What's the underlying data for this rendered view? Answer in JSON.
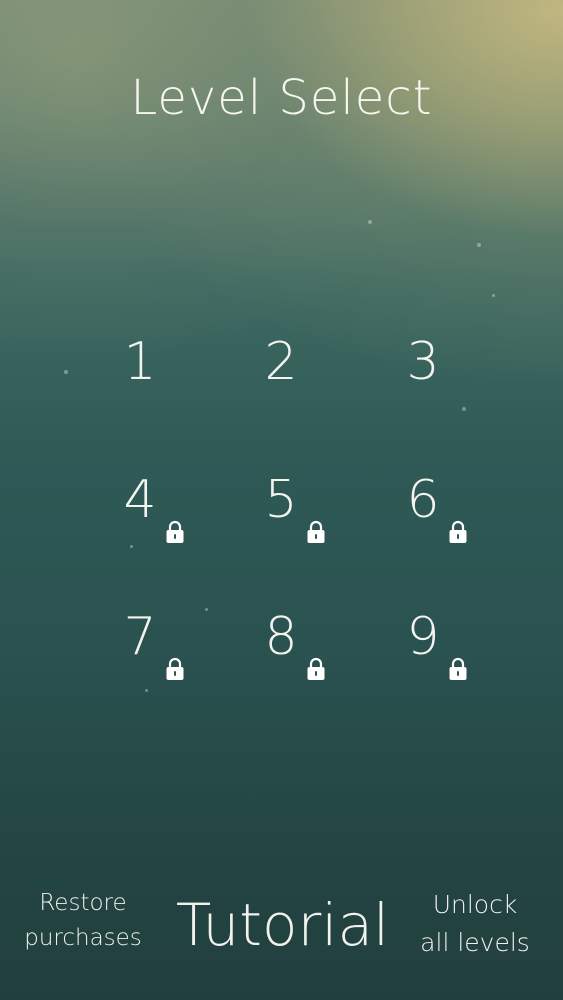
{
  "screen": {
    "title": "Level Select"
  },
  "levels": [
    {
      "number": "1",
      "locked": false
    },
    {
      "number": "2",
      "locked": false
    },
    {
      "number": "3",
      "locked": false
    },
    {
      "number": "4",
      "locked": true
    },
    {
      "number": "5",
      "locked": true
    },
    {
      "number": "6",
      "locked": true
    },
    {
      "number": "7",
      "locked": true
    },
    {
      "number": "8",
      "locked": true
    },
    {
      "number": "9",
      "locked": true
    }
  ],
  "footer": {
    "restore_line1": "Restore",
    "restore_line2": "purchases",
    "tutorial_label": "Tutorial",
    "unlock_line1": "Unlock",
    "unlock_line2": "all levels"
  },
  "icons": {
    "lock": "lock-icon"
  },
  "colors": {
    "text": "#f3f4ee",
    "bg_top_glow": "#c4b880",
    "bg_mid": "#2f5a56",
    "bg_bottom": "#213f3e"
  }
}
